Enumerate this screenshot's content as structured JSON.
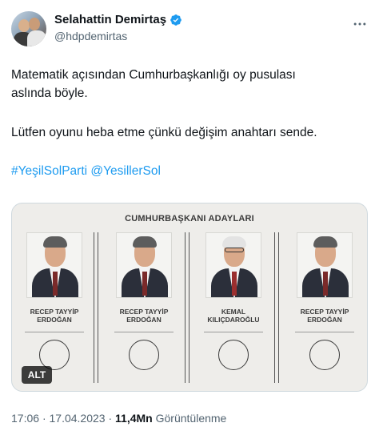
{
  "author": {
    "display_name": "Selahattin Demirtaş",
    "handle": "@hdpdemirtas",
    "verified_color": "#1d9bf0"
  },
  "tweet": {
    "line1": "Matematik açısından Cumhurbaşkanlığı oy pusulası",
    "line2": "aslında böyle.",
    "line3": "Lütfen oyunu heba etme çünkü değişim anahtarı sende.",
    "hashtag1": "#YeşilSolParti",
    "mention1": "@YesillerSol"
  },
  "media": {
    "ballot_title": "CUMHURBAŞKANI ADAYLARI",
    "alt_label": "ALT",
    "candidates": [
      {
        "name_line1": "RECEP TAYYİP",
        "name_line2": "ERDOĞAN"
      },
      {
        "name_line1": "RECEP TAYYİP",
        "name_line2": "ERDOĞAN"
      },
      {
        "name_line1": "KEMAL",
        "name_line2": "KILIÇDAROĞLU"
      },
      {
        "name_line1": "RECEP TAYYİP",
        "name_line2": "ERDOĞAN"
      }
    ]
  },
  "meta": {
    "time": "17:06",
    "date": "17.04.2023",
    "separator": "·",
    "views_count": "11,4Mn",
    "views_label": "Görüntülenme"
  },
  "colors": {
    "link": "#1d9bf0",
    "secondary_text": "#536471",
    "primary_text": "#0f1419"
  },
  "icons": [
    "verified-badge-icon",
    "more-options-icon"
  ]
}
